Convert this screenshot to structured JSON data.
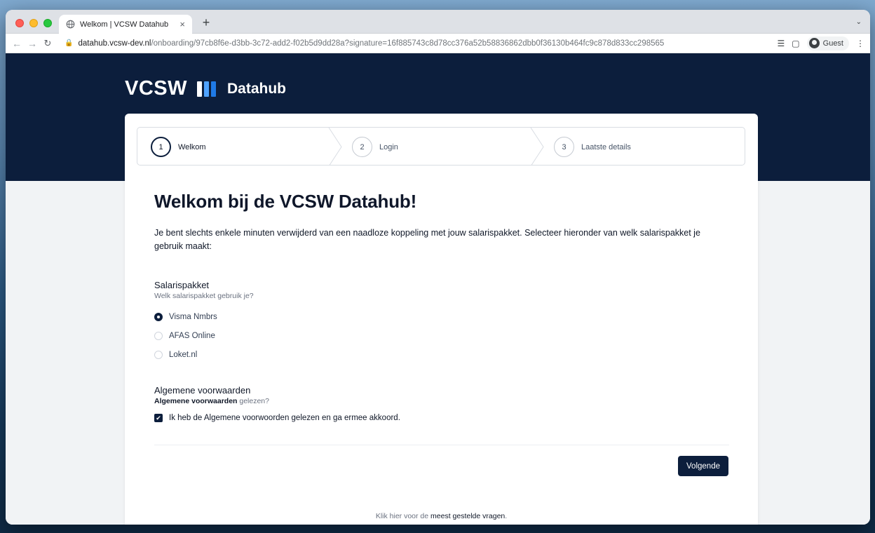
{
  "browser": {
    "tab_title": "Welkom | VCSW Datahub",
    "tab_close": "×",
    "new_tab": "+",
    "tab_menu": "⌄",
    "url_host": "datahub.vcsw-dev.nl",
    "url_path": "/onboarding/97cb8f6e-d3bb-3c72-add2-f02b5d9dd28a?signature=16f885743c8d78cc376a52b58836862dbb0f36130b464fc9c878d833cc298565",
    "profile_label": "Guest"
  },
  "header": {
    "brand": "VCSW",
    "product": "Datahub"
  },
  "steps": [
    {
      "number": "1",
      "label": "Welkom"
    },
    {
      "number": "2",
      "label": "Login"
    },
    {
      "number": "3",
      "label": "Laatste details"
    }
  ],
  "main": {
    "title": "Welkom bij de VCSW Datahub!",
    "intro": "Je bent slechts enkele minuten verwijderd van een naadloze koppeling met jouw salarispakket. Selecteer hieronder van welk salarispakket je gebruik maakt:"
  },
  "salary": {
    "label": "Salarispakket",
    "help": "Welk salarispakket gebruik je?",
    "options": [
      "Visma Nmbrs",
      "AFAS Online",
      "Loket.nl"
    ],
    "selected": "Visma Nmbrs"
  },
  "terms": {
    "label": "Algemene voorwaarden",
    "help_link": "Algemene voorwaarden",
    "help_rest": " gelezen?",
    "checkbox_label": "Ik heb de Algemene voorwoorden gelezen en ga ermee akkoord.",
    "checked": true
  },
  "actions": {
    "next": "Volgende"
  },
  "footer": {
    "text": "Klik hier voor de ",
    "link": "meest gestelde vragen",
    "suffix": "."
  },
  "colors": {
    "navy": "#0c1e3c",
    "accent_blue": "#1f7ae6",
    "light_blue": "#4fa3ff"
  }
}
